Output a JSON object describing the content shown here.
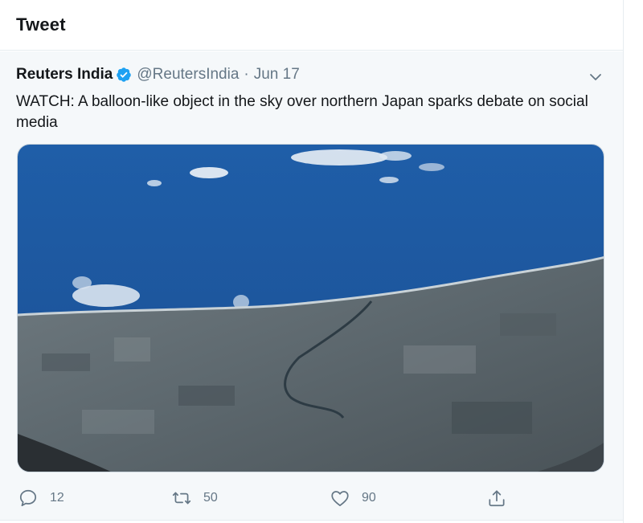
{
  "header": {
    "title": "Tweet"
  },
  "tweet": {
    "author_name": "Reuters India",
    "handle": "@ReutersIndia",
    "separator": "·",
    "date": "Jun 17",
    "text": "WATCH: A balloon-like object in the sky over northern Japan sparks debate on social media",
    "media_icon": "video-thumbnail-aerial-coast",
    "actions": {
      "reply_count": "12",
      "retweet_count": "50",
      "like_count": "90"
    }
  },
  "colors": {
    "text_primary": "#14171a",
    "text_secondary": "#657786",
    "verified_blue": "#1da1f2",
    "tweet_background": "#f5f8fa",
    "border": "#e6ecf0"
  }
}
